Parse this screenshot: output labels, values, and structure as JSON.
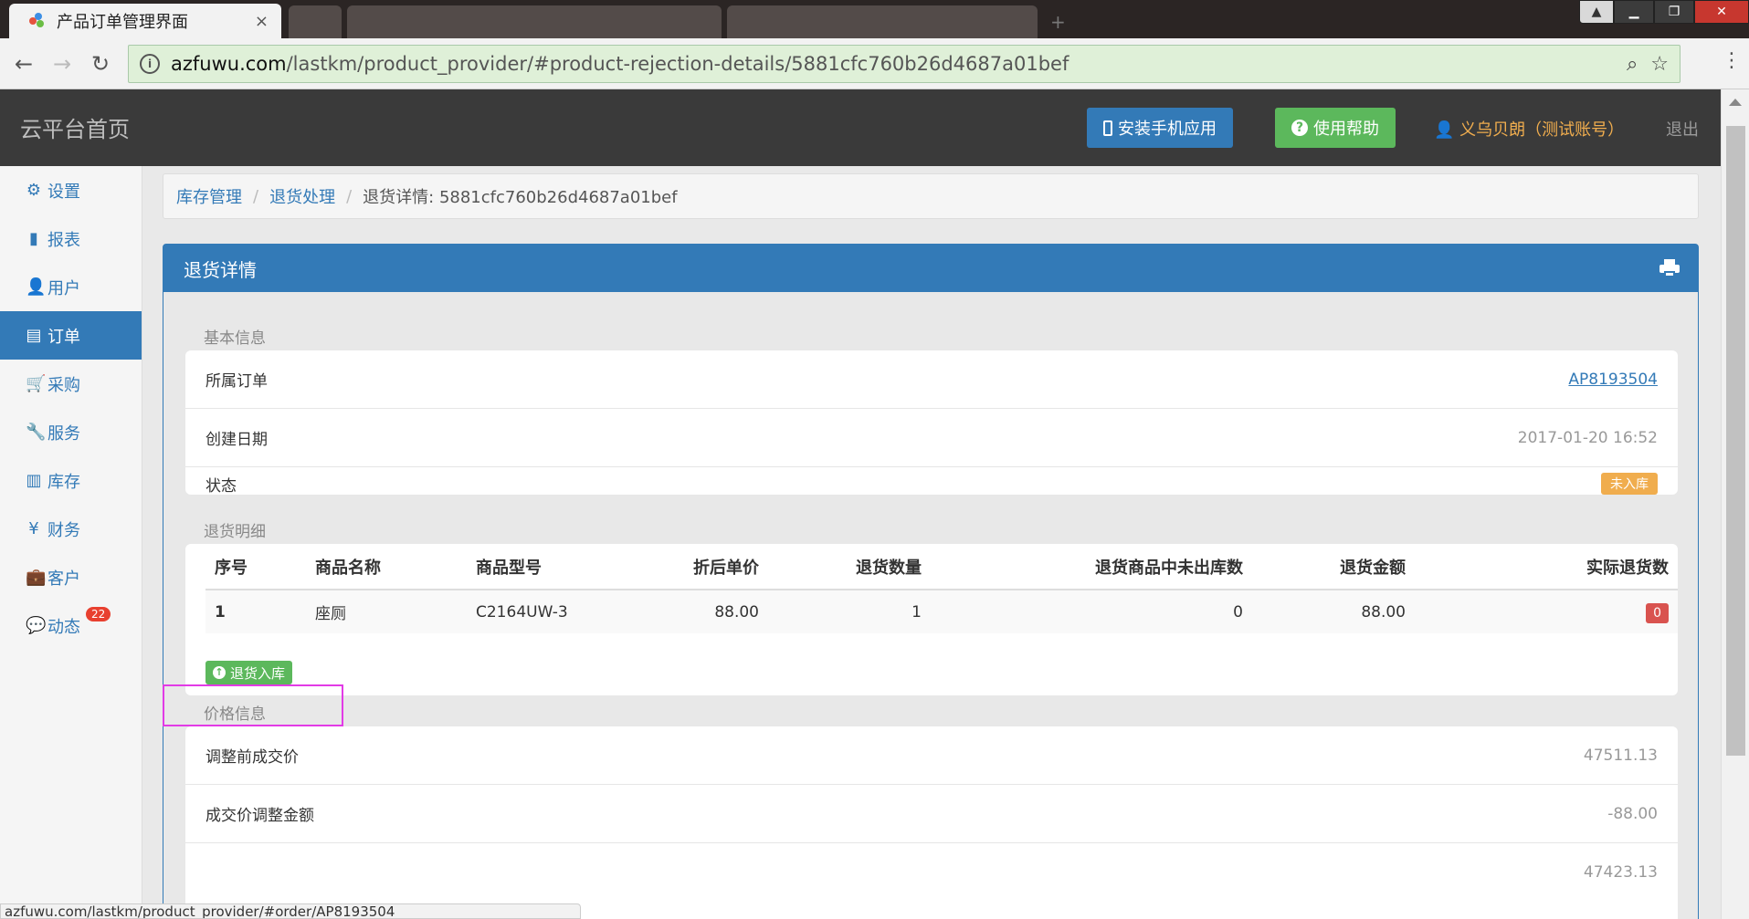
{
  "browser": {
    "tab_title": "产品订单管理界面",
    "tab_close": "×",
    "url_host": "azfuwu.com",
    "url_path": "/lastkm/product_provider/#product-rejection-details/5881cfc760b26d4687a01bef",
    "status_url": "azfuwu.com/lastkm/product_provider/#order/AP8193504"
  },
  "header": {
    "brand": "云平台首页",
    "install_app": "安装手机应用",
    "help": "使用帮助",
    "user": "义乌贝朗（测试账号）",
    "logout": "退出"
  },
  "sidebar": {
    "items": [
      {
        "label": "设置",
        "icon": "gear-icon",
        "glyph": "⚙"
      },
      {
        "label": "报表",
        "icon": "bar-chart-icon",
        "glyph": "▮"
      },
      {
        "label": "用户",
        "icon": "user-icon",
        "glyph": "👤"
      },
      {
        "label": "订单",
        "icon": "list-icon",
        "glyph": "▤"
      },
      {
        "label": "采购",
        "icon": "cart-icon",
        "glyph": "🛒"
      },
      {
        "label": "服务",
        "icon": "wrench-icon",
        "glyph": "🔧"
      },
      {
        "label": "库存",
        "icon": "barcode-icon",
        "glyph": "▥"
      },
      {
        "label": "财务",
        "icon": "yen-icon",
        "glyph": "¥"
      },
      {
        "label": "客户",
        "icon": "briefcase-icon",
        "glyph": "💼"
      },
      {
        "label": "动态",
        "icon": "comment-icon",
        "glyph": "💬",
        "badge": "22"
      }
    ],
    "active_index": 3
  },
  "breadcrumb": {
    "inventory": "库存管理",
    "returns": "退货处理",
    "current": "退货详情: 5881cfc760b26d4687a01bef"
  },
  "panel": {
    "title": "退货详情",
    "basic_title": "基本信息",
    "basic": {
      "order_label": "所属订单",
      "order_value": "AP8193504",
      "date_label": "创建日期",
      "date_value": "2017-01-20 16:52",
      "status_label": "状态",
      "status_value": "未入库"
    },
    "details_title": "退货明细",
    "table": {
      "headers": [
        "序号",
        "商品名称",
        "商品型号",
        "折后单价",
        "退货数量",
        "退货商品中未出库数",
        "退货金额",
        "实际退货数"
      ],
      "rows": [
        [
          "1",
          "座厕",
          "C2164UW-3",
          "88.00",
          "1",
          "0",
          "88.00",
          "0"
        ]
      ]
    },
    "restock_button": "退货入库",
    "price_title": "价格信息",
    "price": {
      "before_label": "调整前成交价",
      "before_value": "47511.13",
      "adjust_label": "成交价调整金额",
      "adjust_value": "-88.00",
      "partial_value": "47423.13"
    }
  },
  "colors": {
    "primary": "#337ab7",
    "success": "#5cb85c",
    "warning": "#f0ad4e",
    "danger": "#d9534f",
    "highlight": "#e23be6"
  }
}
